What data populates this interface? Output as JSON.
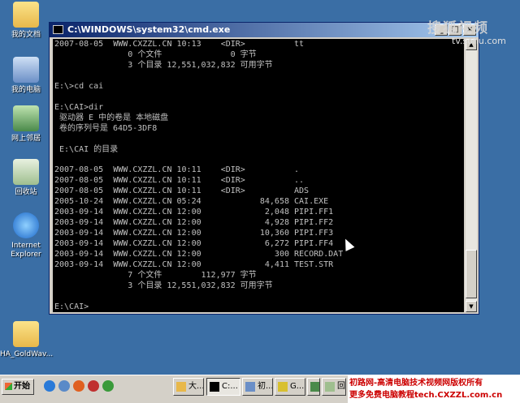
{
  "desktop": {
    "icons": [
      {
        "label": "我的文档"
      },
      {
        "label": "我的电脑"
      },
      {
        "label": "网上邻居"
      },
      {
        "label": "回收站"
      },
      {
        "label": "Internet Explorer"
      },
      {
        "label": "HA_GoldWav..."
      }
    ]
  },
  "window": {
    "title": "C:\\WINDOWS\\system32\\cmd.exe",
    "minimize": "_",
    "maximize": "□",
    "close": "×"
  },
  "console": {
    "text": "2007-08-05  WWW.CXZZL.CN 10:13    <DIR>          tt\n               0 个文件              0 字节\n               3 个目录 12,551,032,832 可用字节\n\nE:\\>cd cai\n\nE:\\CAI>dir\n 驱动器 E 中的卷是 本地磁盘\n 卷的序列号是 64D5-3DF8\n\n E:\\CAI 的目录\n\n2007-08-05  WWW.CXZZL.CN 10:11    <DIR>          .\n2007-08-05  WWW.CXZZL.CN 10:11    <DIR>          ..\n2007-08-05  WWW.CXZZL.CN 10:11    <DIR>          ADS\n2005-10-24  WWW.CXZZL.CN 05:24            84,658 CAI.EXE\n2003-09-14  WWW.CXZZL.CN 12:00             2,048 PIPI.FF1\n2003-09-14  WWW.CXZZL.CN 12:00             4,928 PIPI.FF2\n2003-09-14  WWW.CXZZL.CN 12:00            10,360 PIPI.FF3\n2003-09-14  WWW.CXZZL.CN 12:00             6,272 PIPI.FF4\n2003-09-14  WWW.CXZZL.CN 12:00               300 RECORD.DAT\n2003-09-14  WWW.CXZZL.CN 12:00             4,411 TEST.STR\n               7 个文件        112,977 字节\n               3 个目录 12,551,032,832 可用字节\n\nE:\\CAI>"
  },
  "watermark": {
    "top": "搜狐视频",
    "sub": "tv.sohu.com"
  },
  "taskbar": {
    "start": "开始",
    "tasks": [
      {
        "label": "大..."
      },
      {
        "label": "C:..."
      },
      {
        "label": "初..."
      },
      {
        "label": "G..."
      },
      {
        "label": "..."
      },
      {
        "label": "回..."
      }
    ],
    "banner_line1": "初路网-高清电脑技术视频网版权所有",
    "banner_line2": "更多免费电脑教程tech.CXZZL.com.cn"
  }
}
